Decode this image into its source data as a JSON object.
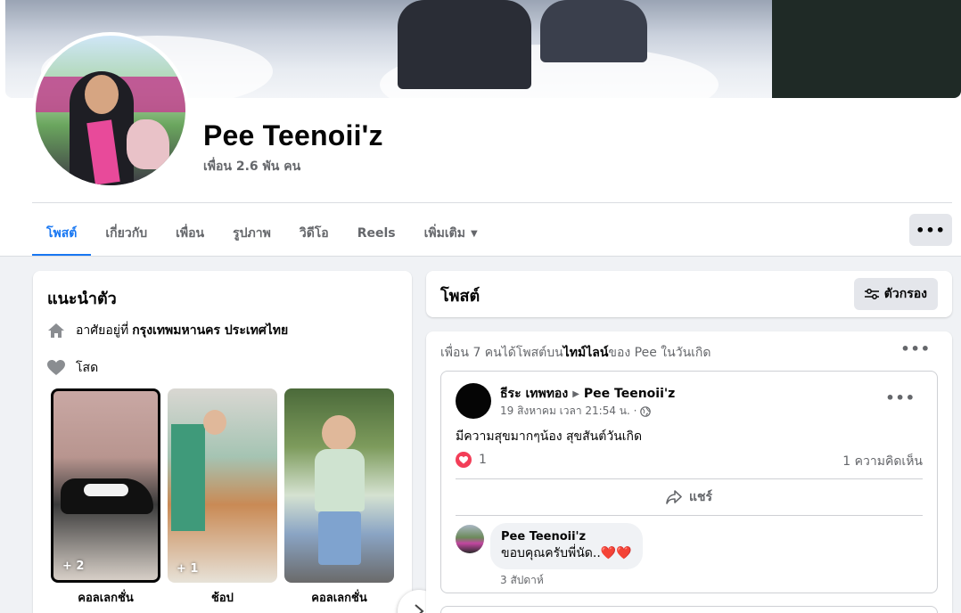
{
  "profile": {
    "name": "Pee Teenoii'z",
    "friends": "เพื่อน 2.6 พัน คน"
  },
  "tabs": [
    {
      "label": "โพสต์",
      "active": true
    },
    {
      "label": "เกี่ยวกับ"
    },
    {
      "label": "เพื่อน"
    },
    {
      "label": "รูปภาพ"
    },
    {
      "label": "วิดีโอ"
    },
    {
      "label": "Reels"
    },
    {
      "label": "เพิ่มเติม",
      "icon": "caret-down-icon"
    }
  ],
  "more_button": {
    "label": "•••",
    "icon": "more-icon"
  },
  "intro": {
    "title": "แนะนำตัว",
    "lives_prefix": "อาศัยอยู่ที่",
    "lives_place": "กรุงเทพมหานคร ประเทศไทย",
    "lives_icon": "home-icon",
    "relationship": "โสด",
    "relationship_icon": "heart-icon",
    "featured": [
      {
        "label": "คอลเลกชั่น",
        "count": "+ 2"
      },
      {
        "label": "ช้อป",
        "count": "+ 1"
      },
      {
        "label": "คอลเลกชั่น",
        "count": ""
      }
    ],
    "next_icon": "chevron-right-icon"
  },
  "posts": {
    "title": "โพสต์",
    "filter_label": "ตัวกรอง",
    "filter_icon": "filter-icon"
  },
  "feed": {
    "header_prefix": "เพื่อน 7 คนได้โพสต์บน",
    "header_bold": "ไทม์ไลน์",
    "header_suffix": "ของ Pee ในวันเกิด",
    "post": {
      "author": "ธีระ เทพทอง",
      "target": "Pee Teenoii'z",
      "time": "19 สิงหาคม เวลา 21:54 น. ·",
      "privacy_icon": "globe-icon",
      "text": "มีความสุขมากๆน้อง สุขสันต์วันเกิด",
      "reaction_count": "1",
      "reaction_icon": "heart-reaction-icon",
      "comments": "1 ความคิดเห็น",
      "share_label": "แชร์",
      "share_icon": "share-icon",
      "comment": {
        "author": "Pee Teenoii'z",
        "text": "ขอบคุณครับพี่นัด..❤️❤️",
        "time": "3 สัปดาห์"
      }
    }
  },
  "colors": {
    "accent": "#1877f2",
    "background": "#f0f2f5",
    "secondary_text": "#65676b",
    "reaction": "#f33e58"
  }
}
